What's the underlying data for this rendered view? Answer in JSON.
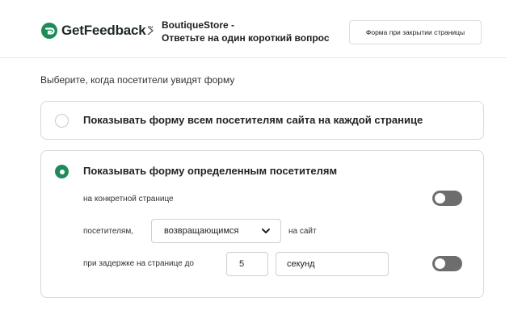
{
  "header": {
    "logo_text": "GetFeedback",
    "logo_tm": "™",
    "breadcrumb_line1": "BoutiqueStore -",
    "breadcrumb_line2": "Ответьте на один короткий вопрос",
    "form_button_label": "Форма при закрытии страницы"
  },
  "main": {
    "subtitle": "Выберите, когда посетители увидят форму",
    "option_all": {
      "label": "Показывать форму всем посетителям сайта на каждой странице",
      "selected": false
    },
    "option_specific": {
      "label": "Показывать форму определенным посетителям",
      "selected": true,
      "rows": {
        "specific_page_label": "на конкретной странице",
        "specific_page_enabled": false,
        "visitors_prefix": "посетителям,",
        "visitors_select_value": "возвращающимся",
        "visitors_suffix": "на сайт",
        "delay_label": "при задержке на странице до",
        "delay_value": "5",
        "delay_unit": "секунд",
        "delay_enabled": false
      }
    }
  },
  "colors": {
    "brand_green": "#1f8a5b",
    "toggle_off": "#6d6d6d"
  },
  "icons": {
    "logo": "getfeedback-logo-icon",
    "breadcrumb_separator": "chevron-right-icon",
    "select_arrow": "chevron-down-icon"
  }
}
